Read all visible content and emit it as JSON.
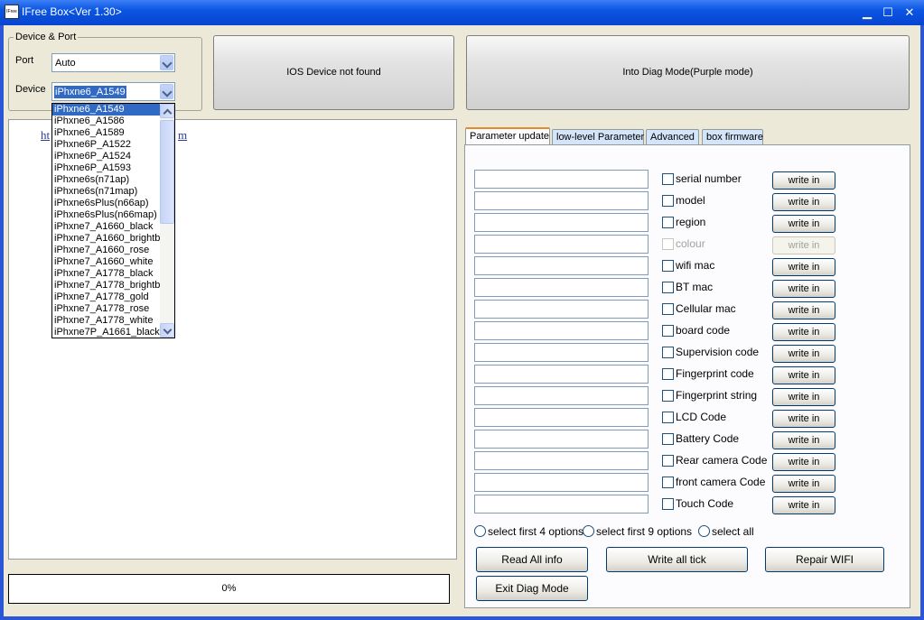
{
  "window": {
    "title": "IFree Box<Ver 1.30>",
    "icon_text": "IFree",
    "minimize_glyph": "▁",
    "maximize_glyph": "☐",
    "close_glyph": "✕"
  },
  "device_port": {
    "legend": "Device & Port",
    "port_label": "Port",
    "port_value": "Auto",
    "device_label": "Device",
    "device_value": "iPhxne6_A1549"
  },
  "status_button": "IOS Device not found",
  "diag_button": "Into Diag Mode(Purple mode)",
  "link_text": "ht",
  "link_tail": "m",
  "progress_text": "0%",
  "device_list": [
    "iPhxne6_A1549",
    "iPhxne6_A1586",
    "iPhxne6_A1589",
    "iPhxne6P_A1522",
    "iPhxne6P_A1524",
    "iPhxne6P_A1593",
    "iPhxne6s(n71ap)",
    "iPhxne6s(n71map)",
    "iPhxne6sPlus(n66ap)",
    "iPhxne6sPlus(n66map)",
    "iPhxne7_A1660_black",
    "iPhxne7_A1660_brightbl",
    "iPhxne7_A1660_rose",
    "iPhxne7_A1660_white",
    "iPhxne7_A1778_black",
    "iPhxne7_A1778_brightbl",
    "iPhxne7_A1778_gold",
    "iPhxne7_A1778_rose",
    "iPhxne7_A1778_white",
    "iPhxne7P_A1661_black"
  ],
  "tabs": [
    {
      "label": "Parameter update",
      "active": true
    },
    {
      "label": "low-level Parameter",
      "active": false
    },
    {
      "label": "Advanced",
      "active": false
    },
    {
      "label": "box firmware",
      "active": false
    }
  ],
  "params": [
    {
      "label": "serial number",
      "button": "write in",
      "disabled": false
    },
    {
      "label": "model",
      "button": "write in",
      "disabled": false
    },
    {
      "label": "region",
      "button": "write in",
      "disabled": false
    },
    {
      "label": "colour",
      "button": "write in",
      "disabled": true
    },
    {
      "label": "wifi mac",
      "button": "write in",
      "disabled": false
    },
    {
      "label": "BT mac",
      "button": "write in",
      "disabled": false
    },
    {
      "label": "Cellular mac",
      "button": "write in",
      "disabled": false
    },
    {
      "label": "board code",
      "button": "write in",
      "disabled": false
    },
    {
      "label": "Supervision code",
      "button": "write in",
      "disabled": false
    },
    {
      "label": "Fingerprint code",
      "button": "write in",
      "disabled": false
    },
    {
      "label": "Fingerprint string",
      "button": "write in",
      "disabled": false
    },
    {
      "label": "LCD Code",
      "button": "write in",
      "disabled": false
    },
    {
      "label": "Battery Code",
      "button": "write in",
      "disabled": false
    },
    {
      "label": "Rear camera Code",
      "button": "write in",
      "disabled": false
    },
    {
      "label": "front camera Code",
      "button": "write in",
      "disabled": false
    },
    {
      "label": "Touch Code",
      "button": "write in",
      "disabled": false
    }
  ],
  "radios": {
    "first4": "select first 4 options",
    "first9": "select first 9 options",
    "all": "select all"
  },
  "actions": {
    "read_all": "Read All info",
    "write_all": "Write all tick",
    "repair_wifi": "Repair WIFI",
    "exit_diag": "Exit Diag Mode"
  }
}
